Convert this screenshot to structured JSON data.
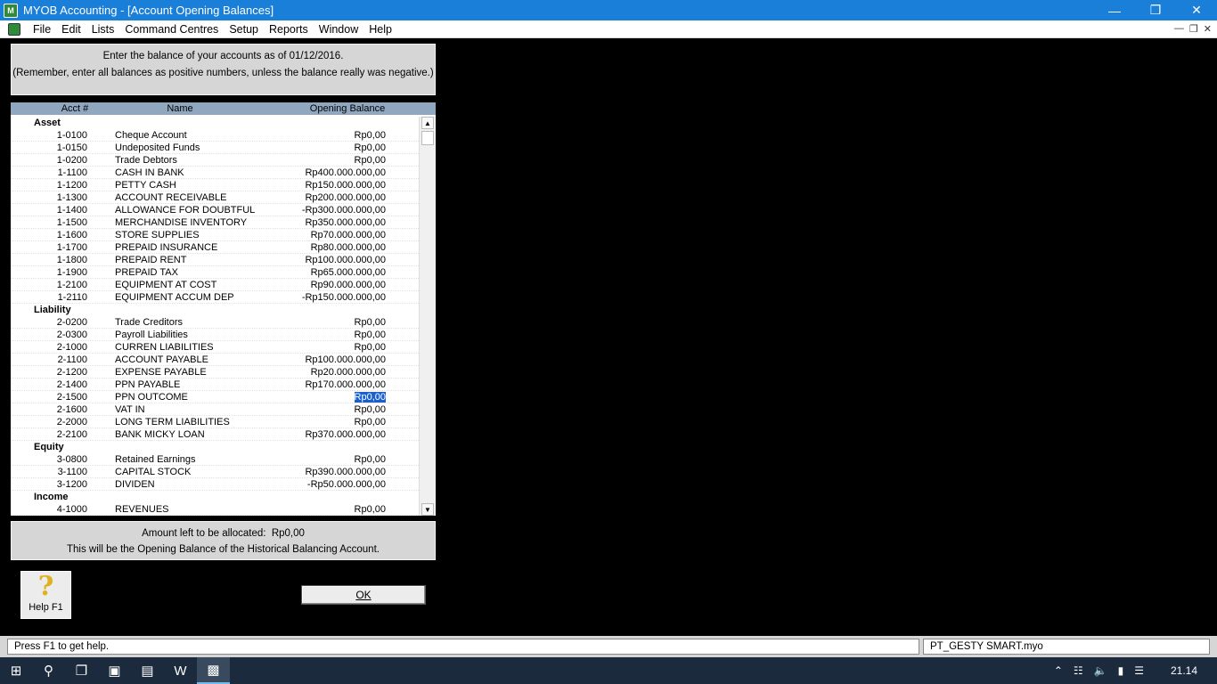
{
  "window": {
    "title": "MYOB Accounting - [Account Opening Balances]"
  },
  "menu": [
    "File",
    "Edit",
    "Lists",
    "Command Centres",
    "Setup",
    "Reports",
    "Window",
    "Help"
  ],
  "instructions": {
    "line1": "Enter the balance of your accounts as of 01/12/2016.",
    "line2": "(Remember, enter all balances as positive numbers, unless the balance really was negative.)"
  },
  "grid": {
    "headers": {
      "acct": "Acct #",
      "name": "Name",
      "balance": "Opening Balance"
    },
    "rows": [
      {
        "section": "Asset"
      },
      {
        "acct": "1-0100",
        "name": "Cheque Account",
        "balance": "Rp0,00"
      },
      {
        "acct": "1-0150",
        "name": "Undeposited Funds",
        "balance": "Rp0,00"
      },
      {
        "acct": "1-0200",
        "name": "Trade Debtors",
        "balance": "Rp0,00"
      },
      {
        "acct": "1-1100",
        "name": "CASH IN BANK",
        "balance": "Rp400.000.000,00"
      },
      {
        "acct": "1-1200",
        "name": "PETTY CASH",
        "balance": "Rp150.000.000,00"
      },
      {
        "acct": "1-1300",
        "name": "ACCOUNT RECEIVABLE",
        "balance": "Rp200.000.000,00"
      },
      {
        "acct": "1-1400",
        "name": "ALLOWANCE FOR DOUBTFUL",
        "balance": "-Rp300.000.000,00"
      },
      {
        "acct": "1-1500",
        "name": "MERCHANDISE INVENTORY",
        "balance": "Rp350.000.000,00"
      },
      {
        "acct": "1-1600",
        "name": "STORE SUPPLIES",
        "balance": "Rp70.000.000,00"
      },
      {
        "acct": "1-1700",
        "name": "PREPAID INSURANCE",
        "balance": "Rp80.000.000,00"
      },
      {
        "acct": "1-1800",
        "name": "PREPAID RENT",
        "balance": "Rp100.000.000,00"
      },
      {
        "acct": "1-1900",
        "name": "PREPAID TAX",
        "balance": "Rp65.000.000,00"
      },
      {
        "acct": "1-2100",
        "name": "EQUIPMENT AT COST",
        "balance": "Rp90.000.000,00"
      },
      {
        "acct": "1-2110",
        "name": "EQUIPMENT ACCUM DEP",
        "balance": "-Rp150.000.000,00"
      },
      {
        "section": "Liability"
      },
      {
        "acct": "2-0200",
        "name": "Trade Creditors",
        "balance": "Rp0,00"
      },
      {
        "acct": "2-0300",
        "name": "Payroll Liabilities",
        "balance": "Rp0,00"
      },
      {
        "acct": "2-1000",
        "name": "CURREN LIABILITIES",
        "balance": "Rp0,00"
      },
      {
        "acct": "2-1100",
        "name": "ACCOUNT PAYABLE",
        "balance": "Rp100.000.000,00"
      },
      {
        "acct": "2-1200",
        "name": "EXPENSE PAYABLE",
        "balance": "Rp20.000.000,00"
      },
      {
        "acct": "2-1400",
        "name": "PPN PAYABLE",
        "balance": "Rp170.000.000,00"
      },
      {
        "acct": "2-1500",
        "name": "PPN OUTCOME",
        "balance": "Rp0,00",
        "selected": true
      },
      {
        "acct": "2-1600",
        "name": "VAT IN",
        "balance": "Rp0,00"
      },
      {
        "acct": "2-2000",
        "name": "LONG TERM LIABILITIES",
        "balance": "Rp0,00"
      },
      {
        "acct": "2-2100",
        "name": "BANK MICKY LOAN",
        "balance": "Rp370.000.000,00"
      },
      {
        "section": "Equity"
      },
      {
        "acct": "3-0800",
        "name": "Retained Earnings",
        "balance": "Rp0,00"
      },
      {
        "acct": "3-1100",
        "name": "CAPITAL STOCK",
        "balance": "Rp390.000.000,00"
      },
      {
        "acct": "3-1200",
        "name": "DIVIDEN",
        "balance": "-Rp50.000.000,00"
      },
      {
        "section": "Income"
      },
      {
        "acct": "4-1000",
        "name": "REVENUES",
        "balance": "Rp0,00"
      }
    ]
  },
  "summary": {
    "label": "Amount left to be allocated:",
    "amount": "Rp0,00",
    "note": "This will be the Opening Balance of the Historical Balancing Account."
  },
  "buttons": {
    "help": "Help F1",
    "ok": "OK"
  },
  "status": {
    "hint": "Press F1 to get help.",
    "file": "PT_GESTY SMART.myo"
  },
  "taskbar": {
    "clock": "21.14"
  }
}
